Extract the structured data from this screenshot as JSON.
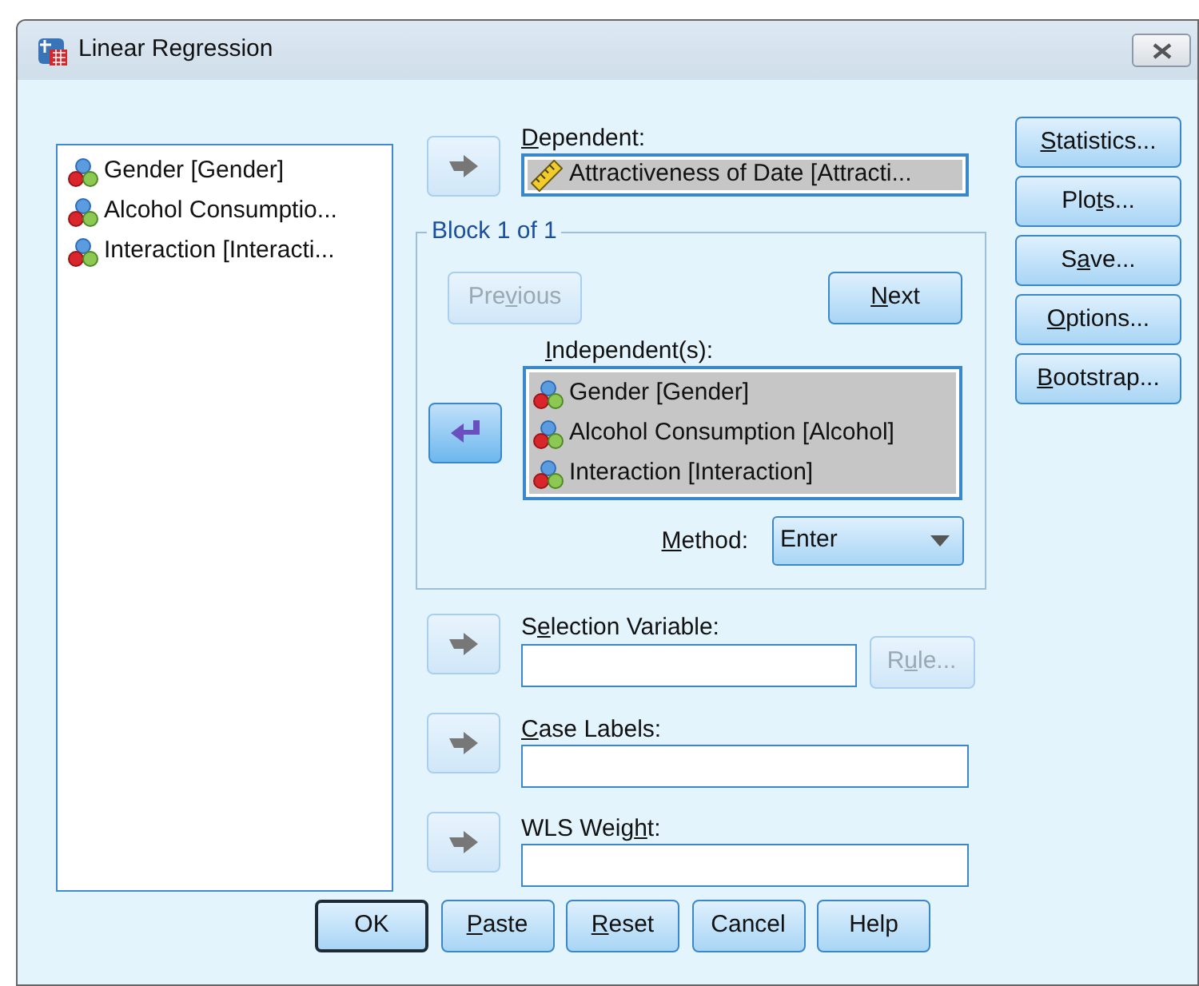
{
  "window": {
    "title": "Linear Regression"
  },
  "variables": [
    {
      "name": "Gender [Gender]",
      "kind": "nominal"
    },
    {
      "name": "Alcohol Consumptio...",
      "kind": "nominal"
    },
    {
      "name": "Interaction [Interacti...",
      "kind": "nominal"
    }
  ],
  "dependent": {
    "arrow": {
      "kind": "right",
      "disabled": true
    },
    "label": {
      "key": "D",
      "post": "ependent:"
    },
    "value": {
      "name": "Attractiveness of Date [Attracti...",
      "kind": "scale"
    }
  },
  "block": {
    "title": "Block 1 of 1",
    "previous": {
      "label": {
        "pre": "Pre",
        "key": "v",
        "post": "ious"
      },
      "disabled": true
    },
    "next": {
      "label": {
        "key": "N",
        "post": "ext"
      },
      "disabled": false
    },
    "independent_label": {
      "key": "I",
      "post": "ndependent(s):"
    },
    "arrow": {
      "kind": "left",
      "disabled": false
    },
    "independents": [
      {
        "name": "Gender [Gender]",
        "kind": "nominal"
      },
      {
        "name": "Alcohol Consumption [Alcohol]",
        "kind": "nominal"
      },
      {
        "name": "Interaction [Interaction]",
        "kind": "nominal"
      }
    ],
    "method_label": {
      "key": "M",
      "post": "ethod:"
    },
    "method": "Enter"
  },
  "selection": {
    "arrow": {
      "kind": "right",
      "disabled": true
    },
    "label": {
      "pre": "S",
      "key": "e",
      "post": "lection Variable:"
    },
    "rule": {
      "label": {
        "pre": "R",
        "key": "u",
        "post": "le..."
      },
      "disabled": true
    }
  },
  "case_labels": {
    "arrow": {
      "kind": "right",
      "disabled": true
    },
    "label": {
      "key": "C",
      "post": "ase Labels:"
    }
  },
  "wls": {
    "arrow": {
      "kind": "right",
      "disabled": true
    },
    "label": {
      "pre": "WLS Weig",
      "key": "h",
      "post": "t:"
    }
  },
  "side_buttons": [
    {
      "label": {
        "key": "S",
        "post": "tatistics..."
      }
    },
    {
      "label": {
        "pre": "Plo",
        "key": "t",
        "post": "s..."
      }
    },
    {
      "label": {
        "pre": "S",
        "key": "a",
        "post": "ve..."
      }
    },
    {
      "label": {
        "key": "O",
        "post": "ptions..."
      }
    },
    {
      "label": {
        "key": "B",
        "post": "ootstrap..."
      }
    }
  ],
  "footer_buttons": [
    {
      "label": {
        "pre": "OK"
      },
      "default": true
    },
    {
      "label": {
        "key": "P",
        "post": "aste"
      },
      "default": false
    },
    {
      "label": {
        "key": "R",
        "post": "eset"
      },
      "default": false
    },
    {
      "label": {
        "pre": "Cancel"
      },
      "default": false
    },
    {
      "label": {
        "pre": "Help"
      },
      "default": false
    }
  ]
}
